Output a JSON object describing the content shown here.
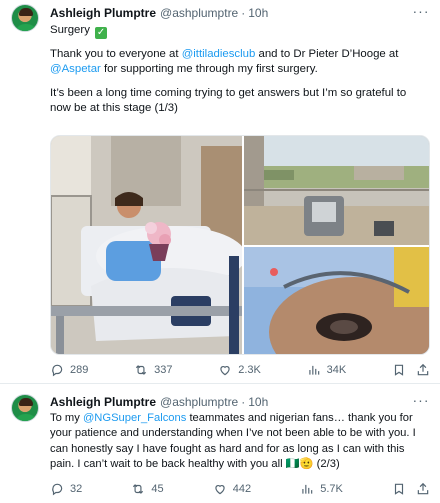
{
  "tweets": [
    {
      "author_name": "Ashleigh Plumptre",
      "handle": "@ashplumptre",
      "dot": "·",
      "time": "10h",
      "more_label": "···",
      "text": {
        "p1": "Surgery",
        "check_emoji": "✅",
        "p2_a": "Thank you to everyone at ",
        "p2_m1": "@ittiladiesclub",
        "p2_b": " and to Dr Pieter D’Hooge at",
        "p2_m2": "@Aspetar",
        "p2_c": " for supporting me through my first surgery.",
        "p3": "It’s been a long time coming trying to get answers but I’m so grateful to now be at this stage (1/3)"
      },
      "media_alts": [
        "hospital-photo",
        "recovery-room-photo",
        "selfie-photo"
      ],
      "stats": {
        "replies": "289",
        "reposts": "337",
        "likes": "2.3K",
        "views": "34K"
      }
    },
    {
      "author_name": "Ashleigh Plumptre",
      "handle": "@ashplumptre",
      "dot": "·",
      "time": "10h",
      "more_label": "···",
      "text": {
        "a": "To my ",
        "m1": "@NGSuper_Falcons",
        "b": " teammates and nigerian fans… thank you for your patience and understanding when I’ve not been able to be with you. I can honestly say I have fought as hard and for as long as I can with this pain. I can’t wait to be back healthy with you all ",
        "emoji": "🇳🇬🫡",
        "c": " (2/3)"
      },
      "stats": {
        "replies": "32",
        "reposts": "45",
        "likes": "442",
        "views": "5.7K"
      }
    }
  ],
  "icons": [
    "reply-icon",
    "repost-icon",
    "like-icon",
    "views-icon",
    "bookmark-icon",
    "share-icon",
    "more-icon"
  ],
  "colors": {
    "link": "#1d9bf0",
    "secondary_text": "#536471",
    "primary_text": "#0f1419",
    "divider": "#e6ebee"
  }
}
